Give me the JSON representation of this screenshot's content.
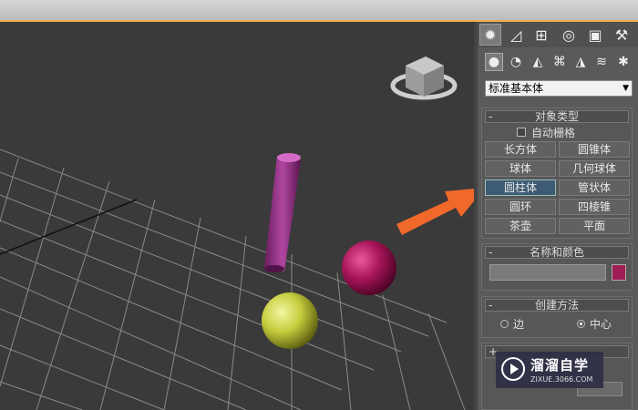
{
  "command_panel": {
    "main_tabs": [
      {
        "icon": "sun-icon",
        "glyph": "✹"
      },
      {
        "icon": "curve-icon",
        "glyph": "◿"
      },
      {
        "icon": "hierarchy-icon",
        "glyph": "⊞"
      },
      {
        "icon": "motion-icon",
        "glyph": "◎"
      },
      {
        "icon": "display-icon",
        "glyph": "▣"
      },
      {
        "icon": "utilities-hammer-icon",
        "glyph": "⚒"
      }
    ],
    "sub_tabs": [
      {
        "icon": "geometry-sphere-icon",
        "glyph": "●"
      },
      {
        "icon": "shapes-icon",
        "glyph": "◔"
      },
      {
        "icon": "lights-icon",
        "glyph": "◭"
      },
      {
        "icon": "camera-icon",
        "glyph": "⌘"
      },
      {
        "icon": "helpers-icon",
        "glyph": "◮"
      },
      {
        "icon": "spacewarps-icon",
        "glyph": "≋"
      },
      {
        "icon": "systems-icon",
        "glyph": "✱"
      }
    ],
    "category_dropdown": "标准基本体"
  },
  "object_type": {
    "title": "对象类型",
    "autogrid_label": "自动栅格",
    "buttons": [
      "长方体",
      "圆锥体",
      "球体",
      "几何球体",
      "圆柱体",
      "管状体",
      "圆环",
      "四棱锥",
      "茶壶",
      "平面"
    ],
    "active_button": "圆柱体"
  },
  "name_color": {
    "title": "名称和颜色",
    "name_value": "",
    "color": "#a01e55"
  },
  "creation_method": {
    "title": "创建方法",
    "options": [
      "边",
      "中心"
    ],
    "selected": "中心"
  },
  "colors": {
    "accent_orange": "#f0682a",
    "cylinder": "#a23a8e",
    "sphere_magenta": "#b01860",
    "sphere_yellow": "#c8d040"
  },
  "watermark": {
    "brand": "溜溜自学",
    "url": "ZIXUE.3066.COM"
  }
}
